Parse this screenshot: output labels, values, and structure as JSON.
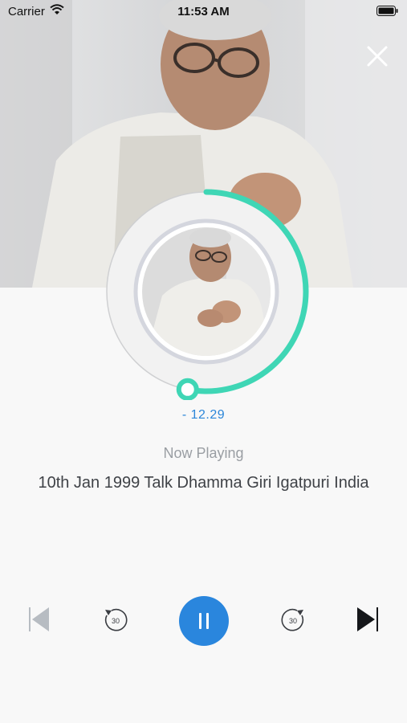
{
  "status_bar": {
    "carrier": "Carrier",
    "time": "11:53 AM"
  },
  "player": {
    "progress_fraction": 0.53,
    "remaining_time": "- 12.29",
    "now_playing_label": "Now Playing",
    "track_title": "10th Jan 1999 Talk Dhamma Giri Igatpuri India"
  },
  "controls": {
    "back_seconds": "30",
    "forward_seconds": "30",
    "state": "playing"
  },
  "colors": {
    "accent_teal": "#3fd6b5",
    "play_blue": "#2a86dd",
    "time_blue": "#2b86d9"
  },
  "icons": [
    "wifi-icon",
    "battery-icon",
    "close-icon",
    "previous-track-icon",
    "rewind-30-icon",
    "pause-icon",
    "forward-30-icon",
    "next-track-icon"
  ]
}
